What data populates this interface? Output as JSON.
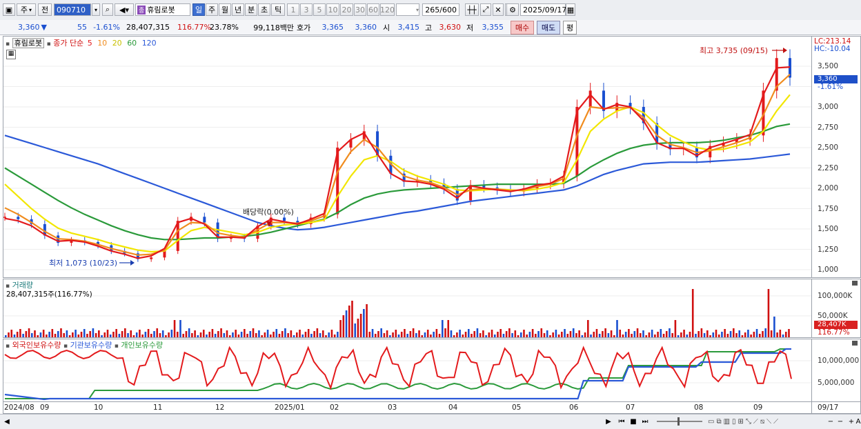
{
  "toolbar": {
    "market": "주",
    "prev": "전",
    "code": "090710",
    "stock_badge": "종",
    "stock_name": "휴림로봇",
    "periods": [
      "일",
      "주",
      "월",
      "년",
      "분",
      "초",
      "틱"
    ],
    "selected_period": "일",
    "intervals": [
      "1",
      "3",
      "5",
      "10",
      "20",
      "30",
      "60",
      "120"
    ],
    "count": "265/600",
    "date": "2025/09/17"
  },
  "info": {
    "price": "3,360",
    "arrow": "▼",
    "change": "55",
    "change_pct": "-1.61%",
    "volume": "28,407,315",
    "volume_ratio": "116.77%",
    "turnover": "23.78%",
    "amount": "99,118백만",
    "quote_label": "호가",
    "bid": "3,365",
    "ask": "3,360",
    "open_label": "시",
    "open": "3,415",
    "high_label": "고",
    "high": "3,630",
    "low_label": "저",
    "low": "3,355",
    "buy": "매수",
    "sell": "매도",
    "eval": "평"
  },
  "price_pane": {
    "legend_name": "휴림로봇",
    "legend_type": "종가 단순",
    "ma": [
      {
        "label": "5",
        "color": "#e31a1c"
      },
      {
        "label": "10",
        "color": "#f08c1e"
      },
      {
        "label": "20",
        "color": "#e0d800"
      },
      {
        "label": "60",
        "color": "#2a9a3a"
      },
      {
        "label": "120",
        "color": "#2b59d8"
      }
    ],
    "high_annotation": "최고 3,735 (09/15)",
    "low_annotation": "최저 1,073 (10/23)",
    "dividend_annotation": "배당락(0.00%)",
    "lc": "LC:213.14",
    "hc": "HC:-10.04",
    "current_price": "3,360",
    "current_pct": "-1.61%",
    "axis_labels": [
      "3,500",
      "3,250",
      "3,000",
      "2,750",
      "2,500",
      "2,250",
      "2,000",
      "1,750",
      "1,500",
      "1,250",
      "1,000"
    ]
  },
  "volume_pane": {
    "title": "거래량",
    "value": "28,407,315주(116.77%)",
    "axis_labels": [
      "100,000K",
      "50,000K"
    ],
    "current": "28,407K",
    "current_pct": "116.77%"
  },
  "holding_pane": {
    "legend": [
      {
        "label": "외국인보유수량",
        "color": "#e31a1c"
      },
      {
        "label": "기관보유수량",
        "color": "#2b59d8"
      },
      {
        "label": "개인보유수량",
        "color": "#2a9a3a"
      }
    ],
    "axis_labels": [
      "10,000,000",
      "5,000,000"
    ]
  },
  "x_axis": {
    "labels": [
      "2024/08",
      "09",
      "10",
      "11",
      "12",
      "2025/01",
      "02",
      "03",
      "04",
      "05",
      "06",
      "07",
      "08",
      "09"
    ],
    "last": "09/17"
  },
  "chart_data": {
    "type": "line",
    "x_labels": [
      "2024/08",
      "09",
      "10",
      "11",
      "12",
      "2025/01",
      "02",
      "03",
      "04",
      "05",
      "06",
      "07",
      "08",
      "09",
      "09/17"
    ],
    "y_axis_ticks": [
      1000,
      1250,
      1500,
      1750,
      2000,
      2250,
      2500,
      2750,
      3000,
      3250,
      3500
    ],
    "close_path": [
      1650,
      1620,
      1560,
      1420,
      1330,
      1360,
      1340,
      1300,
      1230,
      1200,
      1130,
      1150,
      1230,
      1600,
      1650,
      1580,
      1380,
      1400,
      1380,
      1540,
      1640,
      1600,
      1560,
      1640,
      1680,
      2500,
      2600,
      2700,
      2400,
      2180,
      2080,
      2100,
      2060,
      1990,
      1850,
      2040,
      2010,
      1980,
      1960,
      2000,
      2050,
      2060,
      2150,
      3000,
      3200,
      2950,
      3050,
      3000,
      2800,
      2550,
      2480,
      2500,
      2380,
      2520,
      2560,
      2600,
      2650,
      3200,
      3600,
      3360
    ],
    "series": [
      {
        "name": "5",
        "values": [
          1630,
          1600,
          1540,
          1430,
          1350,
          1360,
          1340,
          1290,
          1230,
          1190,
          1140,
          1170,
          1260,
          1580,
          1630,
          1560,
          1400,
          1400,
          1390,
          1530,
          1620,
          1590,
          1560,
          1620,
          1690,
          2450,
          2600,
          2680,
          2420,
          2180,
          2090,
          2080,
          2050,
          1990,
          1880,
          2030,
          2000,
          1980,
          1960,
          1990,
          2040,
          2060,
          2150,
          2950,
          3150,
          2970,
          3030,
          3000,
          2830,
          2560,
          2490,
          2490,
          2400,
          2500,
          2550,
          2600,
          2660,
          3150,
          3480,
          3490
        ]
      },
      {
        "name": "10",
        "values": [
          1760,
          1680,
          1580,
          1470,
          1380,
          1370,
          1350,
          1310,
          1260,
          1220,
          1180,
          1190,
          1240,
          1480,
          1580,
          1570,
          1450,
          1420,
          1400,
          1490,
          1580,
          1580,
          1570,
          1600,
          1660,
          2200,
          2450,
          2600,
          2500,
          2300,
          2150,
          2100,
          2070,
          2010,
          1920,
          1980,
          2000,
          1990,
          1970,
          1980,
          2020,
          2050,
          2120,
          2650,
          3000,
          2980,
          2990,
          2990,
          2870,
          2650,
          2540,
          2500,
          2440,
          2460,
          2510,
          2560,
          2620,
          2900,
          3250,
          3400
        ]
      },
      {
        "name": "20",
        "values": [
          2050,
          1900,
          1750,
          1620,
          1510,
          1450,
          1410,
          1370,
          1320,
          1280,
          1240,
          1220,
          1230,
          1360,
          1480,
          1520,
          1490,
          1460,
          1430,
          1460,
          1520,
          1550,
          1560,
          1580,
          1610,
          1900,
          2150,
          2350,
          2400,
          2330,
          2220,
          2150,
          2100,
          2050,
          1980,
          1970,
          1980,
          1990,
          1980,
          1970,
          1990,
          2020,
          2070,
          2350,
          2700,
          2850,
          2950,
          3000,
          2930,
          2780,
          2650,
          2570,
          2500,
          2470,
          2480,
          2520,
          2570,
          2700,
          2950,
          3150
        ]
      },
      {
        "name": "60",
        "values": [
          2250,
          2150,
          2050,
          1950,
          1850,
          1760,
          1680,
          1610,
          1540,
          1480,
          1430,
          1390,
          1370,
          1370,
          1380,
          1390,
          1390,
          1400,
          1410,
          1430,
          1460,
          1500,
          1540,
          1580,
          1620,
          1700,
          1800,
          1880,
          1930,
          1960,
          1980,
          1990,
          2000,
          2010,
          2020,
          2030,
          2040,
          2050,
          2050,
          2050,
          2050,
          2050,
          2060,
          2150,
          2260,
          2350,
          2430,
          2490,
          2530,
          2550,
          2560,
          2560,
          2560,
          2570,
          2590,
          2620,
          2650,
          2700,
          2760,
          2790
        ]
      },
      {
        "name": "120",
        "values": [
          2650,
          2600,
          2550,
          2500,
          2450,
          2400,
          2350,
          2300,
          2240,
          2180,
          2120,
          2060,
          2000,
          1940,
          1880,
          1820,
          1760,
          1700,
          1640,
          1580,
          1540,
          1510,
          1490,
          1500,
          1520,
          1550,
          1580,
          1610,
          1640,
          1670,
          1700,
          1720,
          1750,
          1780,
          1810,
          1840,
          1860,
          1880,
          1900,
          1920,
          1940,
          1960,
          1980,
          2030,
          2100,
          2170,
          2220,
          2260,
          2300,
          2310,
          2320,
          2320,
          2320,
          2330,
          2340,
          2350,
          2360,
          2380,
          2400,
          2420
        ]
      }
    ]
  }
}
